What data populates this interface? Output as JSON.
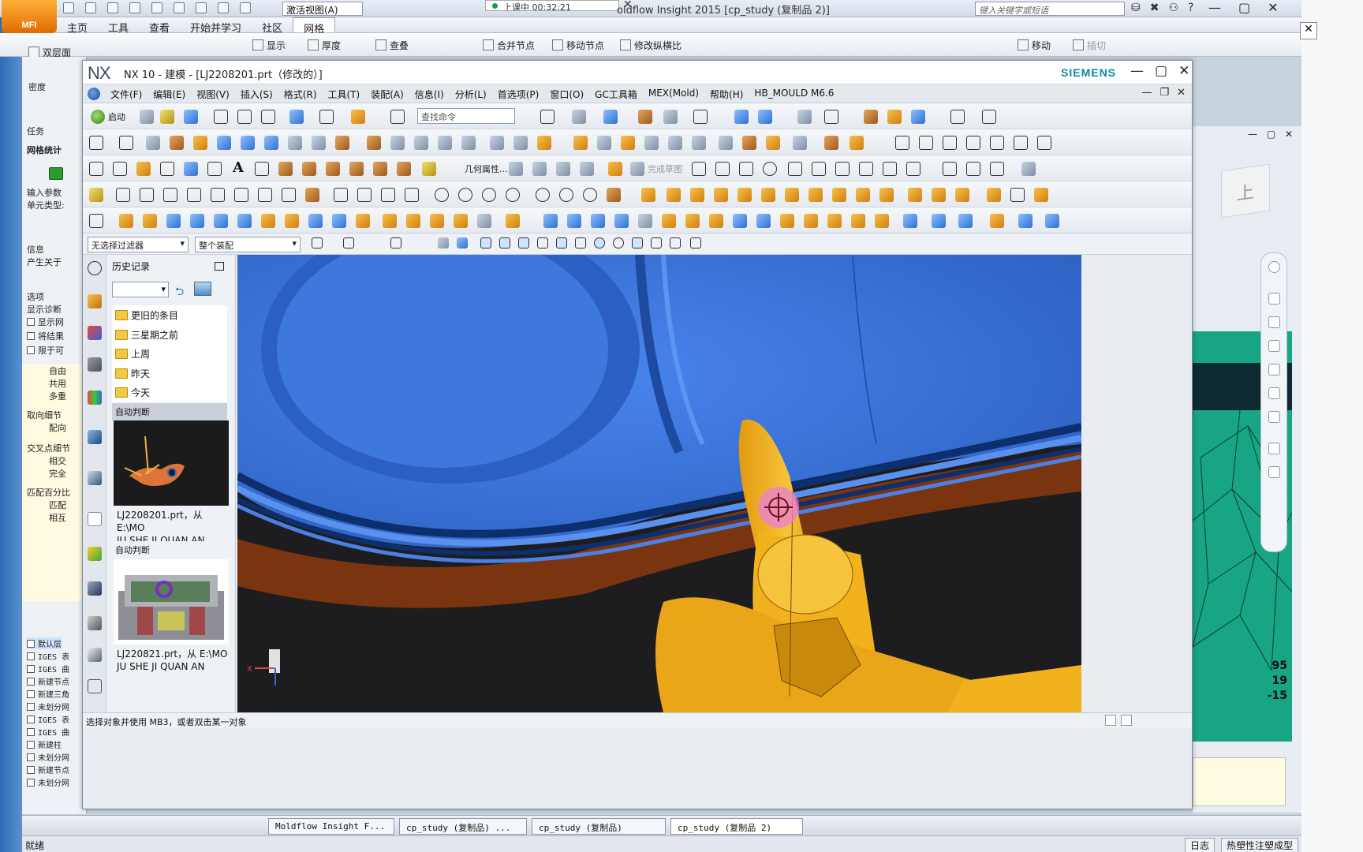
{
  "moldflow": {
    "logo": "MFI",
    "view_select": "激活视图(A)",
    "recording": "上课中 00:32:21",
    "title": "oldflow Insight 2015    [cp_study (复制品 2)]",
    "search_placeholder": "键入关键字或短语",
    "menus": [
      "主页",
      "工具",
      "查看",
      "开始并学习",
      "社区",
      "网格"
    ],
    "active_menu": "网格",
    "ribbon": {
      "tab_left": "双层面",
      "tab_left2": "密度",
      "items": [
        "显示",
        "厚度",
        "查叠",
        "合并节点",
        "移动节点",
        "修改纵横比",
        "移动",
        "插切"
      ]
    },
    "left_panel": {
      "tab": "任务",
      "stats": "网格统计",
      "input": "输入参数",
      "unit": "单元类型:",
      "info": "信息",
      "gen": "产生关于",
      "options": "选项",
      "diag": "显示诊断",
      "opts": [
        "显示网",
        "将结果",
        "限于可"
      ],
      "auto": [
        "自由",
        "共用",
        "多重"
      ],
      "orient": "取向细节",
      "orient2": "配向",
      "cross": "交叉点细节",
      "cross2": "相交",
      "cross3": "完全",
      "match": "匹配百分比",
      "match2": "匹配",
      "match3": "相互"
    },
    "layers": [
      "默认层",
      "IGES 表",
      "IGES 曲",
      "新建节点",
      "新建三角",
      "未划分网",
      "IGES 表",
      "IGES 曲",
      "新建柱",
      "未划分网",
      "新建节点",
      "未划分网"
    ],
    "taskbar": [
      "Moldflow Insight F...",
      "cp_study (复制品) ...",
      "cp_study (复制品)",
      "cp_study (复制品 2)"
    ],
    "status": "就绪",
    "status_right": [
      "日志",
      "热塑性注塑成型"
    ],
    "coords": [
      "95",
      "19",
      "-15"
    ],
    "side_window_btns": "— ▢ ✕",
    "cube_label": "上"
  },
  "nx": {
    "logo": "NX",
    "title": "NX 10 - 建模 - [LJ2208201.prt（修改的）]",
    "brand": "SIEMENS",
    "menus": [
      "文件(F)",
      "编辑(E)",
      "视图(V)",
      "插入(S)",
      "格式(R)",
      "工具(T)",
      "装配(A)",
      "信息(I)",
      "分析(L)",
      "首选项(P)",
      "窗口(O)",
      "GC工具箱",
      "MEX(Mold)",
      "帮助(H)",
      "HB_MOULD M6.6"
    ],
    "toolbar": {
      "start": "启动",
      "search_placeholder": "查找命令",
      "geom_props": "几何属性...",
      "sketch": "完成草图"
    },
    "filters": {
      "type_filter": "无选择过滤器",
      "assembly": "整个装配"
    },
    "history": {
      "title": "历史记录",
      "folders": [
        "更旧的条目",
        "三星期之前",
        "上周",
        "昨天",
        "今天"
      ],
      "group1": "自动判断",
      "file1_line1": "LJ2208201.prt，从 E:\\MO",
      "file1_line2": "JU SHE JI QUAN AN",
      "group2": "自动判断",
      "file2_line1": "LJ220821.prt，从 E:\\MO",
      "file2_line2": "JU SHE JI QUAN AN"
    },
    "status": "选择对象并使用 MB3，或者双击某一对象"
  },
  "colors": {
    "mold_blue": "#4f86e6",
    "part_brown": "#8a3d12",
    "gate_yellow": "#f5b21d",
    "mesh_green": "#17a583",
    "brand_teal": "#0a8aa0"
  }
}
